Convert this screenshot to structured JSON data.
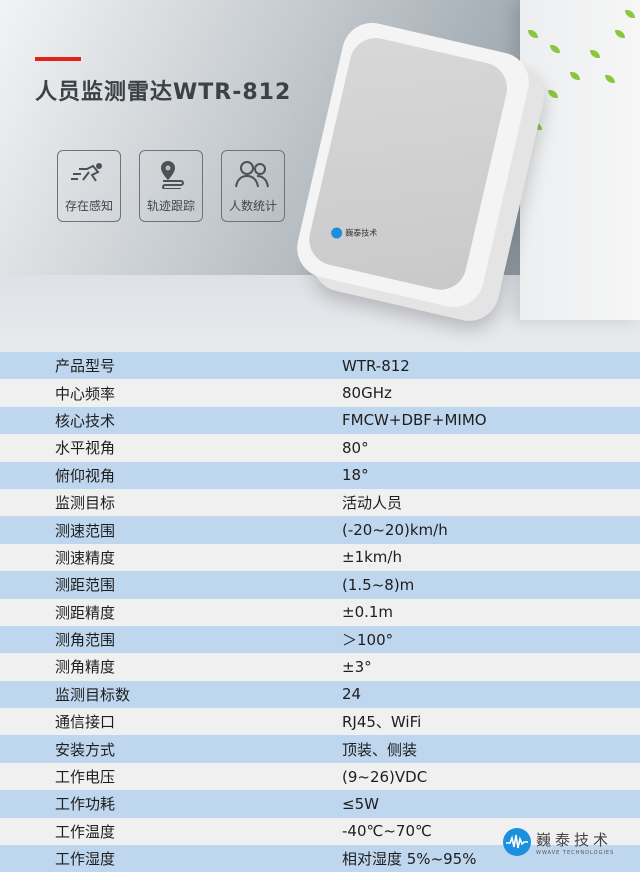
{
  "header": {
    "title": "人员监测雷达WTR-812"
  },
  "features": [
    {
      "icon": "running-person-icon",
      "label": "存在感知"
    },
    {
      "icon": "location-track-icon",
      "label": "轨迹跟踪"
    },
    {
      "icon": "people-icon",
      "label": "人数统计"
    }
  ],
  "specs": [
    {
      "label": "产品型号",
      "value": "WTR-812"
    },
    {
      "label": "中心频率",
      "value": "80GHz"
    },
    {
      "label": "核心技术",
      "value": "FMCW+DBF+MIMO"
    },
    {
      "label": "水平视角",
      "value": "80°"
    },
    {
      "label": "俯仰视角",
      "value": "18°"
    },
    {
      "label": "监测目标",
      "value": "活动人员"
    },
    {
      "label": "测速范围",
      "value": "(-20~20)km/h"
    },
    {
      "label": "测速精度",
      "value": "±1km/h"
    },
    {
      "label": "测距范围",
      "value": "(1.5~8)m"
    },
    {
      "label": "测距精度",
      "value": "±0.1m"
    },
    {
      "label": "测角范围",
      "value": "＞100°"
    },
    {
      "label": "测角精度",
      "value": "±3°"
    },
    {
      "label": "监测目标数",
      "value": "24"
    },
    {
      "label": "通信接口",
      "value": "RJ45、WiFi"
    },
    {
      "label": "安装方式",
      "value": "顶装、侧装"
    },
    {
      "label": "工作电压",
      "value": "(9~26)VDC"
    },
    {
      "label": "工作功耗",
      "value": "≤5W"
    },
    {
      "label": "工作温度",
      "value": "-40℃~70℃"
    },
    {
      "label": "工作湿度",
      "value": "相对湿度 5%~95%"
    }
  ],
  "brand": {
    "name_cn": "巍泰技术",
    "name_en": "WWAVE TECHNOLOGIES"
  },
  "colors": {
    "accent": "#e2231a",
    "row_blue": "#bed6ee",
    "row_grey": "#f0f0f0",
    "logo_blue": "#1a90df"
  }
}
